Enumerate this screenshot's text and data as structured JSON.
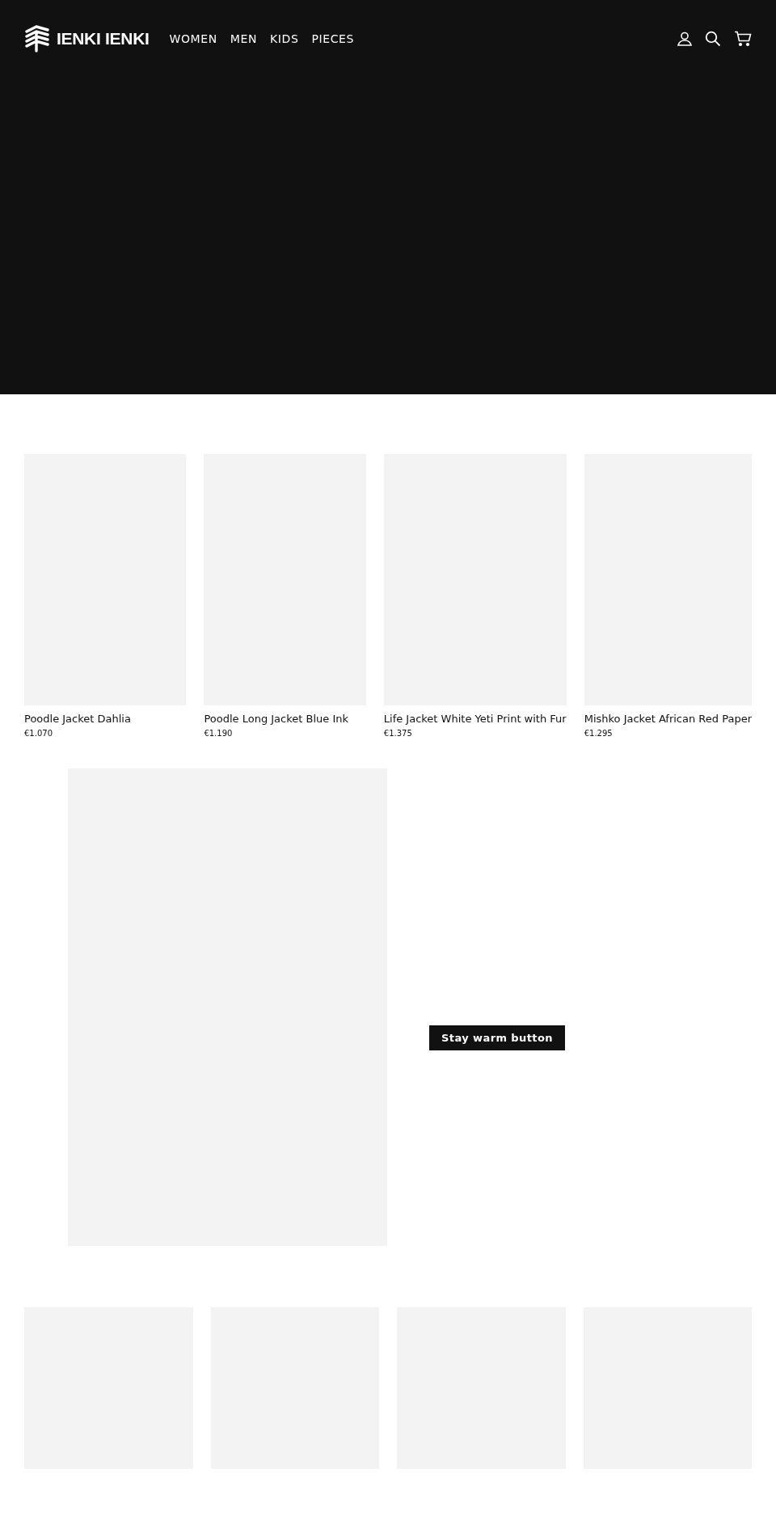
{
  "header": {
    "logo": "IENKI IENKI",
    "nav": [
      {
        "label": "WOMEN"
      },
      {
        "label": "MEN"
      },
      {
        "label": "KIDS"
      },
      {
        "label": "PIECES"
      }
    ]
  },
  "products": [
    {
      "name": "Poodle Jacket Dahlia",
      "price": "€1.070"
    },
    {
      "name": "Poodle Long Jacket Blue Ink",
      "price": "€1.190"
    },
    {
      "name": "Life Jacket White Yeti Print with Fur",
      "price": "€1.375"
    },
    {
      "name": "Mishko Jacket African Red Paper",
      "price": "€1.295"
    }
  ],
  "feature": {
    "button": "Stay warm button"
  }
}
